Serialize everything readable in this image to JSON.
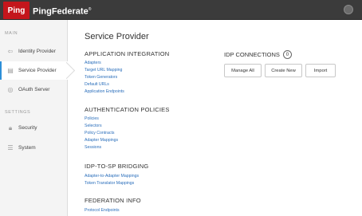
{
  "header": {
    "logo_text": "Ping",
    "product": "PingFederate",
    "trademark": "®"
  },
  "sidebar": {
    "main_heading": "MAIN",
    "settings_heading": "SETTINGS",
    "items": [
      {
        "label": "Identity Provider",
        "icon": "arrow-in-icon"
      },
      {
        "label": "Service Provider",
        "icon": "server-icon"
      },
      {
        "label": "OAuth Server",
        "icon": "oauth-icon"
      },
      {
        "label": "Security",
        "icon": "lock-icon"
      },
      {
        "label": "System",
        "icon": "sliders-icon"
      }
    ]
  },
  "main": {
    "title": "Service Provider",
    "application_integration": {
      "title": "APPLICATION INTEGRATION",
      "links": [
        "Adapters",
        "Target URL Mapping",
        "Token Generators",
        "Default URLs",
        "Application Endpoints"
      ]
    },
    "authentication_policies": {
      "title": "AUTHENTICATION POLICIES",
      "links": [
        "Policies",
        "Selectors",
        "Policy Contracts",
        "Adapter Mappings",
        "Sessions"
      ]
    },
    "idp_to_sp_bridging": {
      "title": "IDP-TO-SP BRIDGING",
      "links": [
        "Adapter-to-Adapter Mappings",
        "Token Translator Mappings"
      ]
    },
    "federation_info": {
      "title": "FEDERATION INFO",
      "links": [
        "Protocol Endpoints"
      ]
    },
    "idp_connections": {
      "title": "IDP CONNECTIONS",
      "count": "0",
      "buttons": [
        "Manage All",
        "Create New",
        "Import"
      ]
    }
  }
}
